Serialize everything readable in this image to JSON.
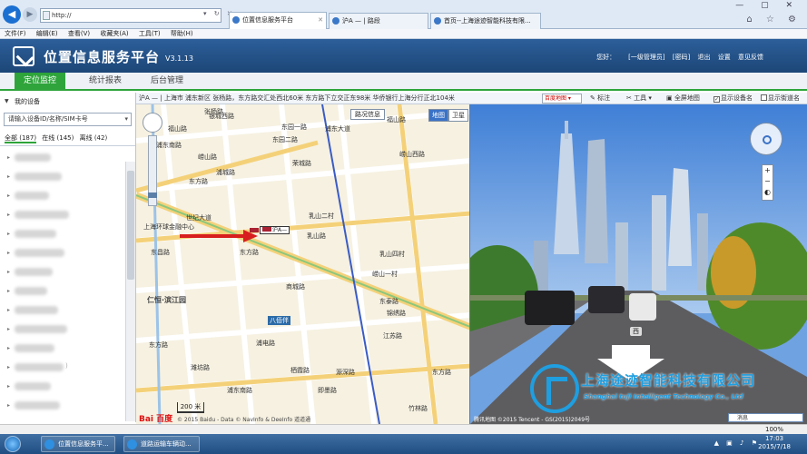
{
  "browser": {
    "back_icon": "arrow-left-icon",
    "address": "http://",
    "address_tools": "▾ ↻ ✕",
    "tabs": [
      {
        "label": "位置信息服务平台"
      },
      {
        "label": "沪A — | 路段"
      },
      {
        "label": "首页--上海途迹智能科技有限..."
      }
    ],
    "window_controls": "— ▢ ✕",
    "favorites_icons": "⌂ ☆ ⚙"
  },
  "menu": [
    "文件(F)",
    "编辑(E)",
    "查看(V)",
    "收藏夹(A)",
    "工具(T)",
    "帮助(H)"
  ],
  "header": {
    "title": "位置信息服务平台",
    "version": "V3.1.13",
    "greeting": "您好：",
    "user": "[一级管理员]",
    "links": [
      "[密码]",
      "退出",
      "设置",
      "意见反馈"
    ]
  },
  "main_tabs": [
    "定位监控",
    "统计报表",
    "后台管理"
  ],
  "sidebar": {
    "title": "我的设备",
    "search_placeholder": "请输入设备ID/名称/SIM卡号",
    "filters": [
      "全部 (187)",
      "在线 (145)",
      "离线 (42)"
    ],
    "items": [
      {
        "name": "",
        "hidden_suffix": ""
      },
      {
        "name": "",
        "hidden_suffix": ""
      },
      {
        "name": "",
        "hidden_suffix": ""
      },
      {
        "name": "",
        "hidden_suffix": ""
      },
      {
        "name": "",
        "hidden_suffix": ""
      },
      {
        "name": "",
        "hidden_suffix": ""
      },
      {
        "name": "",
        "hidden_suffix": ""
      },
      {
        "name": "",
        "hidden_suffix": ""
      },
      {
        "name": "",
        "hidden_suffix": ""
      },
      {
        "name": "",
        "hidden_suffix": ""
      },
      {
        "name": "",
        "hidden_suffix": ""
      },
      {
        "name": "",
        "hidden_suffix": ")"
      },
      {
        "name": "",
        "hidden_suffix": ""
      },
      {
        "name": "",
        "hidden_suffix": ""
      }
    ]
  },
  "map_toolbar": {
    "address": "沪A — | 上海市 浦东新区 张杨路，东方路交汇处西北60米 东方路下立交正东98米 华侨银行上海分行正北104米",
    "map_select": "百度地图 ▾",
    "mark": "标注",
    "tools": "工具 ▾",
    "fullscreen": "全屏地图",
    "show_device_name": "显示设备名",
    "show_street_name": "显示街道名"
  },
  "map": {
    "type_buttons": [
      "地图",
      "卫星"
    ],
    "street_button": "路况信息",
    "car_label": "沪A—",
    "scale": "200 米",
    "logo": "Bai 百度",
    "copyright": "© 2015 Baidu - Data © NavInfo & DeeInfo 道道通",
    "district_badge": "八佰伴",
    "labels": [
      "张杨路",
      "银城西路",
      "浦东南路",
      "东园一路",
      "东园二路",
      "崂山路",
      "福山路",
      "浦东大道",
      "荣城路",
      "浦城路",
      "东方路",
      "世纪大道",
      "东昌路",
      "商城路",
      "乳山路",
      "浦电路",
      "仁恒·滨江园",
      "锦绣路",
      "乳山四村",
      "上海环球金融中心",
      "东泰路",
      "江苏路",
      "福山路",
      "崂山西路",
      "源深路",
      "栖霞路",
      "浦东南路",
      "东方路",
      "东方路",
      "竹林路",
      "潍坊路",
      "崂山一村",
      "东方路",
      "即墨路",
      "乳山二村"
    ]
  },
  "street_view": {
    "direction": "西",
    "company_cn": "上海途迹智能科技有限公司",
    "company_en": "Shanghai tuji Intelligent Technology Co., Ltd",
    "footer": "腾讯地图  ©2015 Tencent - GS(2015)2049号",
    "message": "消息"
  },
  "status_bar": {
    "zoom": "100%"
  },
  "taskbar": {
    "items": [
      "位置信息服务平...",
      "道路运输车辆动..."
    ],
    "time": "17:03",
    "date": "2015/7/18"
  },
  "colors": {
    "header": "#2d5f9a",
    "tab_active": "#2ea43b",
    "logo_blue": "#1f9ee0"
  }
}
